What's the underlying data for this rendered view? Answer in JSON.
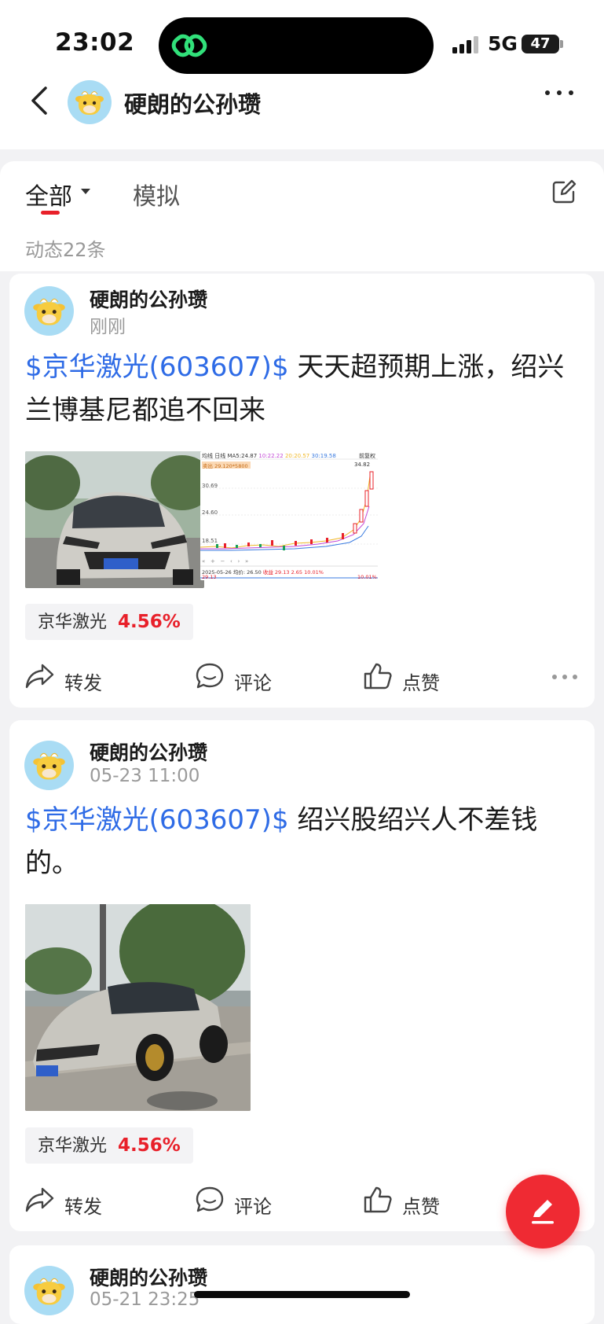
{
  "status": {
    "time": "23:02",
    "network": "5G",
    "battery": "47"
  },
  "header": {
    "title": "硬朗的公孙瓒"
  },
  "tabs": {
    "all": "全部",
    "mock": "模拟"
  },
  "count_text": "动态22条",
  "posts": [
    {
      "user": "硬朗的公孙瓒",
      "time": "刚刚",
      "stock_tag": "$京华激光(603607)$",
      "text": " 天天超预期上涨，绍兴兰博基尼都追不回来",
      "quote_name": "京华激光",
      "quote_pct": "4.56%"
    },
    {
      "user": "硬朗的公孙瓒",
      "time": "05-23 11:00",
      "stock_tag": "$京华激光(603607)$",
      "text": " 绍兴股绍兴人不差钱的。",
      "quote_name": "京华激光",
      "quote_pct": "4.56%"
    },
    {
      "user": "硬朗的公孙瓒",
      "time": "05-21 23:25"
    }
  ],
  "chart_thumb": {
    "type_label": "均线",
    "period": "日线",
    "ma5": "MA5:24.87",
    "ma10": "10:22.22",
    "ma20": "20:20.57",
    "ma30": "30:19.58",
    "adjust": "前复权",
    "marker": "卖出 29.120*5800",
    "high": "34.82",
    "y_labels": [
      "30.69",
      "24.60",
      "18.51"
    ],
    "date": "2025-05-26",
    "avg": "均价: 26.50",
    "gain": "收益 29.13",
    "change": "2.65",
    "pct": "10.01%",
    "bottom_left": "29.13",
    "bottom_right": "10.01%"
  },
  "actions": {
    "forward": "转发",
    "comment": "评论",
    "like": "点赞"
  },
  "colors": {
    "accent": "#e8202a",
    "link": "#2e6be6",
    "fab": "#ef2a33"
  }
}
